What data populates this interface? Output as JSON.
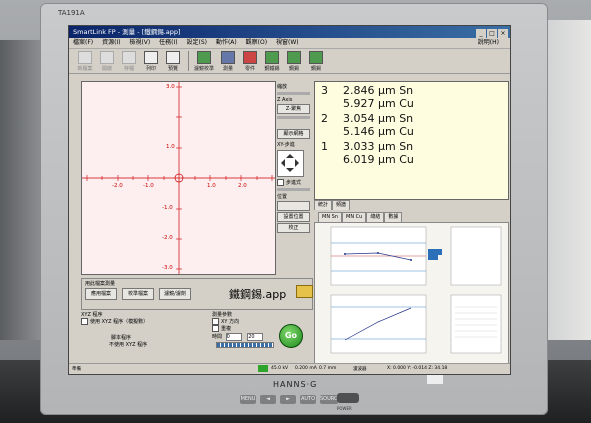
{
  "monitor": {
    "model": "TA191A",
    "brand": "HANNS·G",
    "sticker": "",
    "power_label": "POWER"
  },
  "bezel_buttons": [
    "MENU",
    "◄",
    "►",
    "AUTO",
    "SOURCE"
  ],
  "window": {
    "title": "SmartLink FP - 測量 - [鐵鋼錫.app]",
    "controls": [
      "_",
      "□",
      "×"
    ]
  },
  "menu": {
    "items": [
      "檔案(F)",
      "資源(I)",
      "檢視(V)",
      "任務(I)",
      "設定(S)",
      "動作(A)",
      "觀察(O)",
      "視窗(W)"
    ],
    "help": "說明(H)"
  },
  "toolbar": {
    "items": [
      {
        "label": "新檔案",
        "icon": "new-file-icon",
        "enabled": false
      },
      {
        "label": "開啟",
        "icon": "open-folder-icon",
        "enabled": false
      },
      {
        "label": "存檔",
        "icon": "save-icon",
        "enabled": false
      },
      {
        "label": "列印",
        "icon": "print-icon",
        "enabled": true
      },
      {
        "label": "預覽",
        "icon": "preview-icon",
        "enabled": true
      },
      {
        "label": "濾鏡校準",
        "icon": "calibration-icon",
        "enabled": true
      },
      {
        "label": "測量",
        "icon": "measure-icon",
        "enabled": true
      },
      {
        "label": "零件",
        "icon": "part-icon",
        "enabled": true
      },
      {
        "label": "鋼鐵錫",
        "icon": "layer-icon",
        "enabled": true
      },
      {
        "label": "鋼錫",
        "icon": "layer-icon",
        "enabled": true
      },
      {
        "label": "鋼錫",
        "icon": "layer-icon",
        "enabled": true
      }
    ]
  },
  "view": {
    "x_ticks": [
      "-2.0",
      "-1.0",
      "1.0",
      "2.0"
    ],
    "y_ticks": [
      "3.0",
      "1.0",
      "-1.0",
      "-2.0",
      "-3.0"
    ],
    "y_tick_top": "3.0",
    "y_tick_bottom": "-3.0"
  },
  "controls": {
    "zoom_label": "縮放",
    "z_axis_label": "Z Axis",
    "z_focus_button": "Z-聚焦",
    "grid_button": "顯示網格",
    "xy_label": "XY-步進",
    "step_label": "步進式",
    "position_label": "位置",
    "set_position": "設置位置",
    "calibrate": "校正"
  },
  "results": {
    "layers": [
      {
        "index": "3",
        "lines": [
          "2.846 µm Sn",
          "5.927 µm Cu"
        ]
      },
      {
        "index": "2",
        "lines": [
          "3.054 µm Sn",
          "5.146 µm Cu"
        ]
      },
      {
        "index": "1",
        "lines": [
          "3.033 µm Sn",
          "6.019 µm Cu"
        ]
      }
    ]
  },
  "results_tabs": [
    "統計",
    "頻譜"
  ],
  "stat_tabs": [
    "MN Sn",
    "MN Cu",
    "總結",
    "數據"
  ],
  "panel": {
    "title": "用此檔案測量",
    "buttons": [
      "應用檔案",
      "校準檔案",
      "濾鏡/濾劑"
    ],
    "app_name": "鐵鋼錫.app"
  },
  "xyz": {
    "title": "XYZ 程序",
    "use_xyz": "使用 XYZ 程序（模擬數）",
    "multi": "腳本程序",
    "no_xyz": "不使用 XYZ 程序"
  },
  "measurement": {
    "title": "測量參數",
    "xy_dir": "XY 方向",
    "repeat": "重複",
    "time_label": "時間",
    "time_value": "0",
    "count_value": "20",
    "go": "Go"
  },
  "status": {
    "voltage": "45.0 kV",
    "current": "0.200 mA",
    "spot": "0.7 mm",
    "state": "濾波器",
    "coords": "X: 0.000  Y: -0.014  Z: 34.18",
    "prefix": "準備"
  },
  "colors": {
    "go_button": "#1f8a1f",
    "view_bg": "#fdeeef",
    "results_bg": "#fffde0",
    "axis": "#c00000"
  }
}
